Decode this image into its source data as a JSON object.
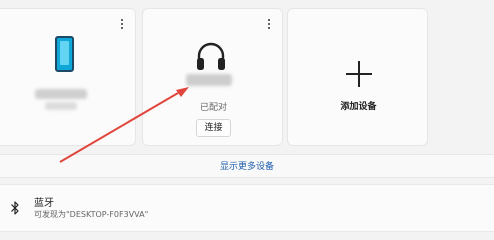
{
  "cards": {
    "headset": {
      "status": "已配对",
      "connect_label": "连接"
    },
    "add_device": {
      "label": "添加设备"
    }
  },
  "show_more": {
    "label": "显示更多设备"
  },
  "bluetooth": {
    "title": "蓝牙",
    "discoverable_text": "可发现为\"DESKTOP-F0F3VVA\""
  },
  "colors": {
    "link": "#1f5fad",
    "annotation_arrow": "#e0463c",
    "phone_icon": "#0ea7d8"
  }
}
